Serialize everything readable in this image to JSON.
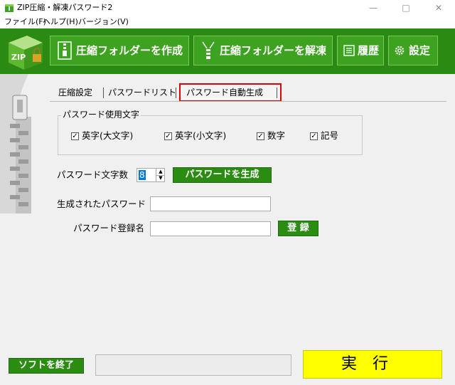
{
  "window": {
    "title": "ZIP圧縮・解凍パスワード2",
    "minimize": "—",
    "maximize": "□",
    "close": "✕"
  },
  "menu": [
    "ファイル(F)",
    "ヘルプ(H)",
    "バージョン(V)"
  ],
  "toolbar": {
    "logo_text": "ZIP",
    "create_label": "圧縮フォルダーを作成",
    "extract_label": "圧縮フォルダーを解凍",
    "history_label": "履歴",
    "settings_label": "設定",
    "bg_color": "#2a8a12",
    "button_color": "#3da21f"
  },
  "tabs": [
    "圧縮設定",
    "パスワードリスト",
    "パスワード自動生成"
  ],
  "active_tab_index": 2,
  "charset_group": {
    "legend": "パスワード使用文字",
    "options": [
      {
        "label": "英字(大文字)",
        "checked": true
      },
      {
        "label": "英字(小文字)",
        "checked": true
      },
      {
        "label": "数字",
        "checked": true
      },
      {
        "label": "記号",
        "checked": true
      }
    ]
  },
  "length": {
    "label": "パスワード文字数",
    "value": "8"
  },
  "generate_button": "パスワードを生成",
  "generated": {
    "label": "生成されたパスワード",
    "value": ""
  },
  "register": {
    "label": "パスワード登録名",
    "value": "",
    "button": "登 録"
  },
  "bottom": {
    "exit_button": "ソフトを終了",
    "status": "",
    "run_button": "実行"
  },
  "colors": {
    "accent_green": "#2b8c12",
    "run_yellow": "#ffff00",
    "tab_highlight": "#e00000"
  }
}
